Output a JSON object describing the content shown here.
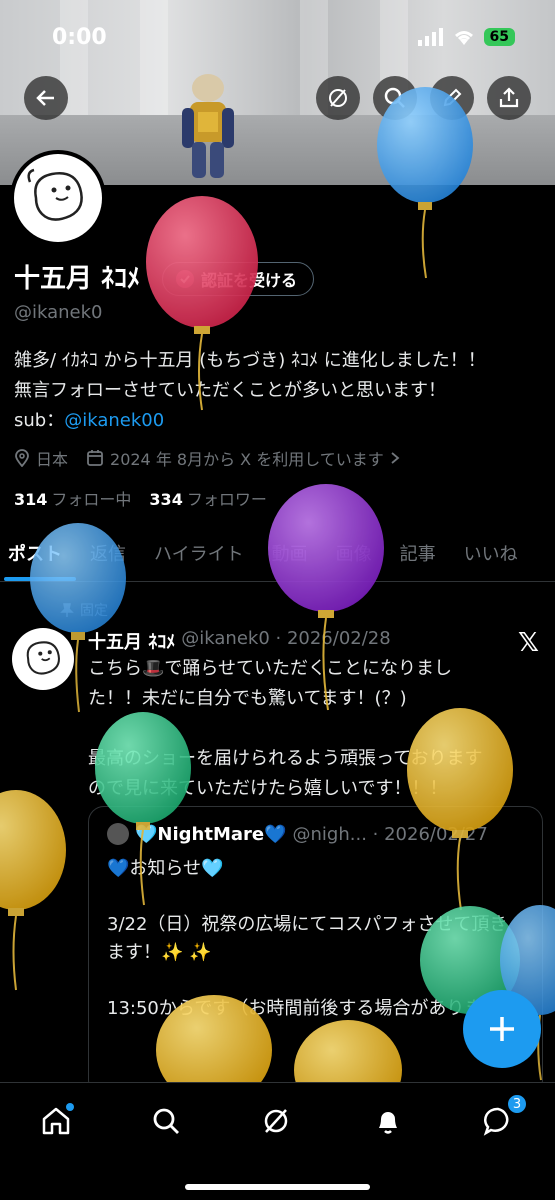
{
  "status_bar": {
    "time": "0:00",
    "battery": "65"
  },
  "profile": {
    "name": "十五月 ﾈｺﾒ",
    "verify_button": "認証を受ける",
    "handle": "@ikanek0",
    "bio_line1": "雑多/ ｲｶﾈｺ から十五月 (もちづき) ﾈｺﾒ に進化しました！！",
    "bio_line2": "無言フォローさせていただくことが多いと思います！",
    "bio_sub_label": "sub：",
    "bio_sub_link": "@ikanek00",
    "location": "日本",
    "joined": "2024 年 8月から X を利用しています",
    "following_count": "314",
    "following_label": "フォロー中",
    "followers_count": "334",
    "followers_label": "フォロワー"
  },
  "tabs": [
    "ポスト",
    "返信",
    "ハイライト",
    "動画",
    "画像",
    "記事",
    "いいね"
  ],
  "pinned_label": "固定",
  "tweet": {
    "name": "十五月 ﾈｺﾒ",
    "handle_date": "@ikanek0 · 2026/02/28",
    "line1": "こちら🎩で踊らせていただくことになりまし",
    "line2": "た！！未だに自分でも驚いてます！(？)",
    "line3": "最高のショーを届けられるよう頑張っております",
    "line4": "ので見に来ていただけたら嬉しいです！！！"
  },
  "quote": {
    "name": "🩵NightMare💙",
    "handle_date": "@nigh... · 2026/02/27",
    "body": "💙お知らせ🩵\n\n3/22（日）祝祭の広場にてコスパフォさせて頂きます！✨ ✨\n\n13:50からです（お時間前後する場合があります）"
  },
  "nav": {
    "messages_badge": "3"
  },
  "colors": {
    "accent": "#1d9bf0",
    "background": "#000000",
    "muted": "#71767b"
  }
}
